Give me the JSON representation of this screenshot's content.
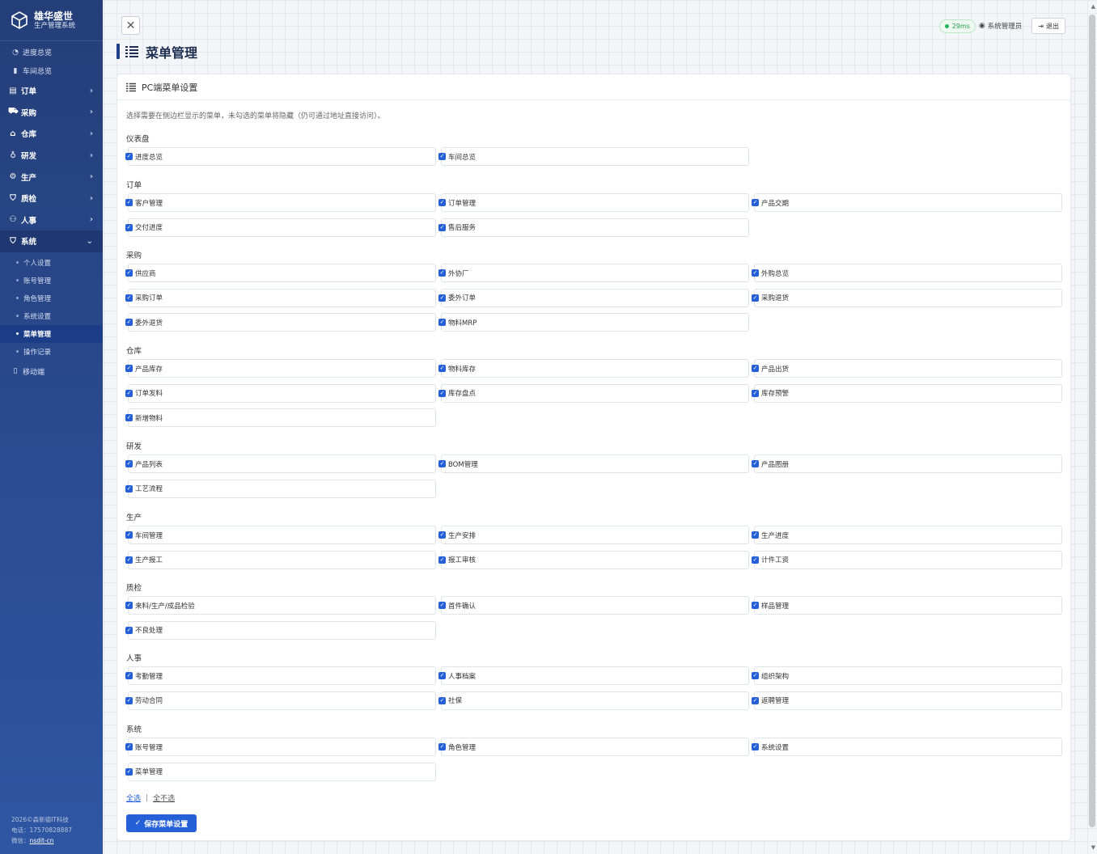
{
  "app": {
    "title": "雄华盛世",
    "subtitle": "生产管理系统"
  },
  "sidebar": {
    "top_items": [
      {
        "label": "进度总览",
        "icon": "gauge-icon"
      },
      {
        "label": "车间总览",
        "icon": "document-icon"
      }
    ],
    "groups": [
      {
        "label": "订单",
        "icon": "ledger-icon"
      },
      {
        "label": "采购",
        "icon": "cart-icon"
      },
      {
        "label": "仓库",
        "icon": "warehouse-icon"
      },
      {
        "label": "研发",
        "icon": "lightbulb-icon"
      },
      {
        "label": "生产",
        "icon": "gear-icon"
      },
      {
        "label": "质检",
        "icon": "shield-icon"
      },
      {
        "label": "人事",
        "icon": "people-icon"
      },
      {
        "label": "系统",
        "icon": "shield-icon"
      }
    ],
    "system_items": [
      "个人设置",
      "账号管理",
      "角色管理",
      "系统设置",
      "菜单管理",
      "操作记录"
    ],
    "mobile_label": "移动端",
    "footer": {
      "copyright": "2026©森新德IT科技",
      "phone": "电话：17570828887",
      "wechat_label": "微信：",
      "wechat_id": "nsdit-cn"
    }
  },
  "header": {
    "latency": "29ms",
    "user": "系统管理员",
    "logout": "退出"
  },
  "page": {
    "title": "菜单管理"
  },
  "card": {
    "title": "PC端菜单设置",
    "hint": "选择需要在侧边栏显示的菜单，未勾选的菜单将隐藏（仍可通过地址直接访问）。",
    "sections": [
      {
        "title": "仪表盘",
        "items": [
          "进度总览",
          "车间总览"
        ]
      },
      {
        "title": "订单",
        "items": [
          "客户管理",
          "订单管理",
          "产品交期",
          "交付进度",
          "售后服务"
        ]
      },
      {
        "title": "采购",
        "items": [
          "供应商",
          "外协厂",
          "外购总览",
          "采购订单",
          "委外订单",
          "采购退货",
          "委外退货",
          "物料MRP"
        ]
      },
      {
        "title": "仓库",
        "items": [
          "产品库存",
          "物料库存",
          "产品出货",
          "订单发料",
          "库存盘点",
          "库存预警",
          "新增物料"
        ]
      },
      {
        "title": "研发",
        "items": [
          "产品列表",
          "BOM管理",
          "产品图册",
          "工艺流程"
        ]
      },
      {
        "title": "生产",
        "items": [
          "车间管理",
          "生产安排",
          "生产进度",
          "生产报工",
          "报工审核",
          "计件工资"
        ]
      },
      {
        "title": "质检",
        "items": [
          "来料/生产/成品检验",
          "首件确认",
          "样品管理",
          "不良处理"
        ]
      },
      {
        "title": "人事",
        "items": [
          "考勤管理",
          "人事档案",
          "组织架构",
          "劳动合同",
          "社保",
          "返聘管理"
        ]
      },
      {
        "title": "系统",
        "items": [
          "账号管理",
          "角色管理",
          "系统设置",
          "菜单管理"
        ]
      }
    ],
    "select_all": "全选",
    "select_none": "全不选",
    "save_label": "保存菜单设置"
  }
}
